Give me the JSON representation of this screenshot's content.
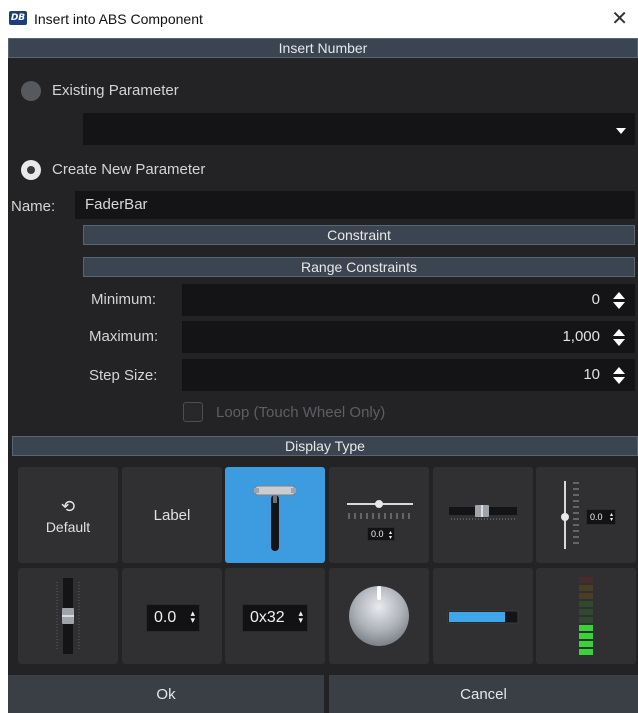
{
  "window": {
    "title": "Insert into ABS Component",
    "icon_label": "DB",
    "close_glyph": "✕"
  },
  "header": {
    "title": "Insert Number"
  },
  "existing": {
    "label": "Existing Parameter",
    "selected": false,
    "dropdown_value": ""
  },
  "create_new": {
    "label": "Create New Parameter",
    "selected": true
  },
  "name": {
    "label": "Name:",
    "value": "FaderBar"
  },
  "constraint": {
    "header": "Constraint",
    "range_header": "Range Constraints",
    "minimum": {
      "label": "Minimum:",
      "value": "0"
    },
    "maximum": {
      "label": "Maximum:",
      "value": "1,000"
    },
    "step_size": {
      "label": "Step Size:",
      "value": "10"
    },
    "loop": {
      "label": "Loop (Touch Wheel Only)",
      "checked": false,
      "enabled": false
    }
  },
  "display_type": {
    "header": "Display Type",
    "selected_index": 2,
    "tiles": [
      {
        "name": "default",
        "label": "Default",
        "icon": "reset-icon"
      },
      {
        "name": "label",
        "label": "Label"
      },
      {
        "name": "fader-bar",
        "icon": "t-handle-fader-icon"
      },
      {
        "name": "horizontal-slider-with-spinner",
        "value_text": "0.0"
      },
      {
        "name": "horizontal-fader",
        "icon": "horizontal-fader-icon"
      },
      {
        "name": "vertical-slider-with-spinner",
        "value_text": "0.0"
      },
      {
        "name": "vertical-fader",
        "icon": "vertical-fader-icon"
      },
      {
        "name": "decimal-spinner",
        "value_text": "0.0"
      },
      {
        "name": "hex-spinner",
        "value_text": "0x32"
      },
      {
        "name": "knob",
        "icon": "knob-icon"
      },
      {
        "name": "progress-bar",
        "icon": "progress-bar-icon"
      },
      {
        "name": "level-meter",
        "icon": "level-meter-icon"
      }
    ]
  },
  "buttons": {
    "ok": "Ok",
    "cancel": "Cancel"
  },
  "colors": {
    "panel_bg": "#232326",
    "header_bg": "#3b4551",
    "selected_tile": "#3d9be0",
    "meter_green": "#39d23a"
  }
}
